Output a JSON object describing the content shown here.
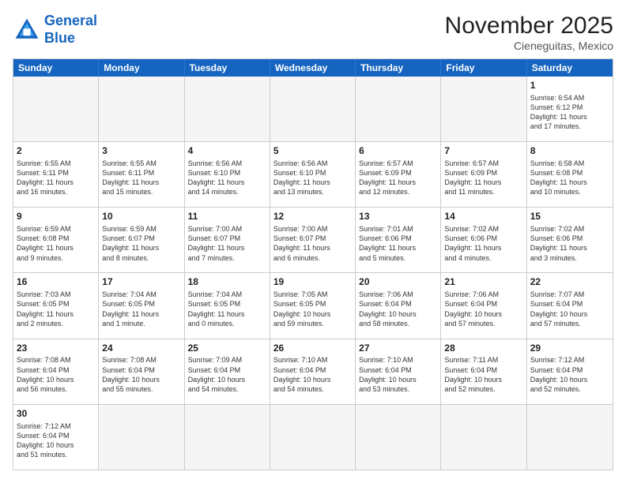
{
  "header": {
    "logo_general": "General",
    "logo_blue": "Blue",
    "month_title": "November 2025",
    "location": "Cieneguitas, Mexico"
  },
  "days": [
    "Sunday",
    "Monday",
    "Tuesday",
    "Wednesday",
    "Thursday",
    "Friday",
    "Saturday"
  ],
  "cells": [
    {
      "day": "",
      "info": "",
      "empty": true
    },
    {
      "day": "",
      "info": "",
      "empty": true
    },
    {
      "day": "",
      "info": "",
      "empty": true
    },
    {
      "day": "",
      "info": "",
      "empty": true
    },
    {
      "day": "",
      "info": "",
      "empty": true
    },
    {
      "day": "",
      "info": "",
      "empty": true
    },
    {
      "day": "1",
      "info": "Sunrise: 6:54 AM\nSunset: 6:12 PM\nDaylight: 11 hours\nand 17 minutes."
    },
    {
      "day": "2",
      "info": "Sunrise: 6:55 AM\nSunset: 6:11 PM\nDaylight: 11 hours\nand 16 minutes."
    },
    {
      "day": "3",
      "info": "Sunrise: 6:55 AM\nSunset: 6:11 PM\nDaylight: 11 hours\nand 15 minutes."
    },
    {
      "day": "4",
      "info": "Sunrise: 6:56 AM\nSunset: 6:10 PM\nDaylight: 11 hours\nand 14 minutes."
    },
    {
      "day": "5",
      "info": "Sunrise: 6:56 AM\nSunset: 6:10 PM\nDaylight: 11 hours\nand 13 minutes."
    },
    {
      "day": "6",
      "info": "Sunrise: 6:57 AM\nSunset: 6:09 PM\nDaylight: 11 hours\nand 12 minutes."
    },
    {
      "day": "7",
      "info": "Sunrise: 6:57 AM\nSunset: 6:09 PM\nDaylight: 11 hours\nand 11 minutes."
    },
    {
      "day": "8",
      "info": "Sunrise: 6:58 AM\nSunset: 6:08 PM\nDaylight: 11 hours\nand 10 minutes."
    },
    {
      "day": "9",
      "info": "Sunrise: 6:59 AM\nSunset: 6:08 PM\nDaylight: 11 hours\nand 9 minutes."
    },
    {
      "day": "10",
      "info": "Sunrise: 6:59 AM\nSunset: 6:07 PM\nDaylight: 11 hours\nand 8 minutes."
    },
    {
      "day": "11",
      "info": "Sunrise: 7:00 AM\nSunset: 6:07 PM\nDaylight: 11 hours\nand 7 minutes."
    },
    {
      "day": "12",
      "info": "Sunrise: 7:00 AM\nSunset: 6:07 PM\nDaylight: 11 hours\nand 6 minutes."
    },
    {
      "day": "13",
      "info": "Sunrise: 7:01 AM\nSunset: 6:06 PM\nDaylight: 11 hours\nand 5 minutes."
    },
    {
      "day": "14",
      "info": "Sunrise: 7:02 AM\nSunset: 6:06 PM\nDaylight: 11 hours\nand 4 minutes."
    },
    {
      "day": "15",
      "info": "Sunrise: 7:02 AM\nSunset: 6:06 PM\nDaylight: 11 hours\nand 3 minutes."
    },
    {
      "day": "16",
      "info": "Sunrise: 7:03 AM\nSunset: 6:05 PM\nDaylight: 11 hours\nand 2 minutes."
    },
    {
      "day": "17",
      "info": "Sunrise: 7:04 AM\nSunset: 6:05 PM\nDaylight: 11 hours\nand 1 minute."
    },
    {
      "day": "18",
      "info": "Sunrise: 7:04 AM\nSunset: 6:05 PM\nDaylight: 11 hours\nand 0 minutes."
    },
    {
      "day": "19",
      "info": "Sunrise: 7:05 AM\nSunset: 6:05 PM\nDaylight: 10 hours\nand 59 minutes."
    },
    {
      "day": "20",
      "info": "Sunrise: 7:06 AM\nSunset: 6:04 PM\nDaylight: 10 hours\nand 58 minutes."
    },
    {
      "day": "21",
      "info": "Sunrise: 7:06 AM\nSunset: 6:04 PM\nDaylight: 10 hours\nand 57 minutes."
    },
    {
      "day": "22",
      "info": "Sunrise: 7:07 AM\nSunset: 6:04 PM\nDaylight: 10 hours\nand 57 minutes."
    },
    {
      "day": "23",
      "info": "Sunrise: 7:08 AM\nSunset: 6:04 PM\nDaylight: 10 hours\nand 56 minutes."
    },
    {
      "day": "24",
      "info": "Sunrise: 7:08 AM\nSunset: 6:04 PM\nDaylight: 10 hours\nand 55 minutes."
    },
    {
      "day": "25",
      "info": "Sunrise: 7:09 AM\nSunset: 6:04 PM\nDaylight: 10 hours\nand 54 minutes."
    },
    {
      "day": "26",
      "info": "Sunrise: 7:10 AM\nSunset: 6:04 PM\nDaylight: 10 hours\nand 54 minutes."
    },
    {
      "day": "27",
      "info": "Sunrise: 7:10 AM\nSunset: 6:04 PM\nDaylight: 10 hours\nand 53 minutes."
    },
    {
      "day": "28",
      "info": "Sunrise: 7:11 AM\nSunset: 6:04 PM\nDaylight: 10 hours\nand 52 minutes."
    },
    {
      "day": "29",
      "info": "Sunrise: 7:12 AM\nSunset: 6:04 PM\nDaylight: 10 hours\nand 52 minutes."
    },
    {
      "day": "30",
      "info": "Sunrise: 7:12 AM\nSunset: 6:04 PM\nDaylight: 10 hours\nand 51 minutes."
    },
    {
      "day": "",
      "info": "",
      "empty": true
    },
    {
      "day": "",
      "info": "",
      "empty": true
    },
    {
      "day": "",
      "info": "",
      "empty": true
    },
    {
      "day": "",
      "info": "",
      "empty": true
    },
    {
      "day": "",
      "info": "",
      "empty": true
    },
    {
      "day": "",
      "info": "",
      "empty": true
    }
  ]
}
